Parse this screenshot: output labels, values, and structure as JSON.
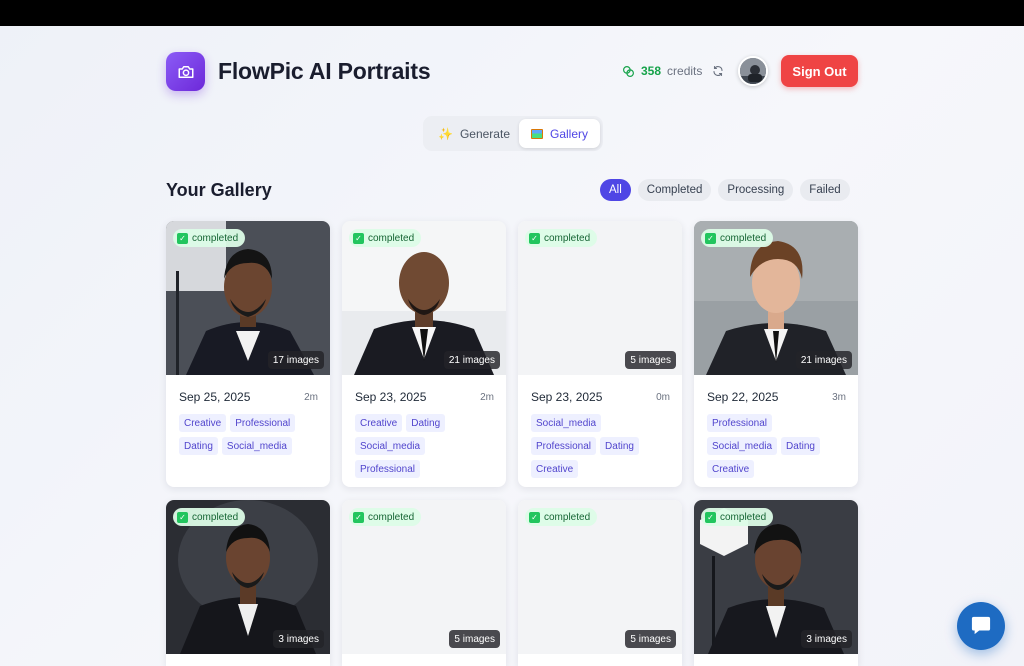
{
  "app": {
    "title": "FlowPic AI Portraits"
  },
  "header": {
    "credits_count": "358",
    "credits_label": "credits",
    "sign_out_label": "Sign Out"
  },
  "tabs": [
    {
      "label": "Generate",
      "icon": "sparkles-icon",
      "active": false
    },
    {
      "label": "Gallery",
      "icon": "image-icon",
      "active": true
    }
  ],
  "gallery": {
    "title": "Your Gallery",
    "filters": [
      {
        "label": "All",
        "active": true
      },
      {
        "label": "Completed",
        "active": false
      },
      {
        "label": "Processing",
        "active": false
      },
      {
        "label": "Failed",
        "active": false
      }
    ],
    "cards": [
      {
        "status": "completed",
        "count": "17 images",
        "date": "Sep 25, 2025",
        "duration": "2m",
        "tags": [
          "Creative",
          "Professional",
          "Dating",
          "Social_media"
        ],
        "image": "studio-portrait"
      },
      {
        "status": "completed",
        "count": "21 images",
        "date": "Sep 23, 2025",
        "duration": "2m",
        "tags": [
          "Creative",
          "Dating",
          "Social_media",
          "Professional"
        ],
        "image": "bald-portrait"
      },
      {
        "status": "completed",
        "count": "5 images",
        "date": "Sep 23, 2025",
        "duration": "0m",
        "tags": [
          "Social_media",
          "Professional",
          "Dating",
          "Creative"
        ],
        "image": "none"
      },
      {
        "status": "completed",
        "count": "21 images",
        "date": "Sep 22, 2025",
        "duration": "3m",
        "tags": [
          "Professional",
          "Social_media",
          "Dating",
          "Creative"
        ],
        "image": "light-portrait"
      },
      {
        "status": "completed",
        "count": "3 images",
        "image": "dark-portrait"
      },
      {
        "status": "completed",
        "count": "5 images",
        "image": "none"
      },
      {
        "status": "completed",
        "count": "5 images",
        "image": "none"
      },
      {
        "status": "completed",
        "count": "3 images",
        "image": "studio-portrait"
      }
    ]
  },
  "colors": {
    "accent": "#4f46e5",
    "sign_out": "#ef4444",
    "credits": "#16a34a",
    "badge_bg": "#dcfce7",
    "chat": "#1e6bc2"
  }
}
